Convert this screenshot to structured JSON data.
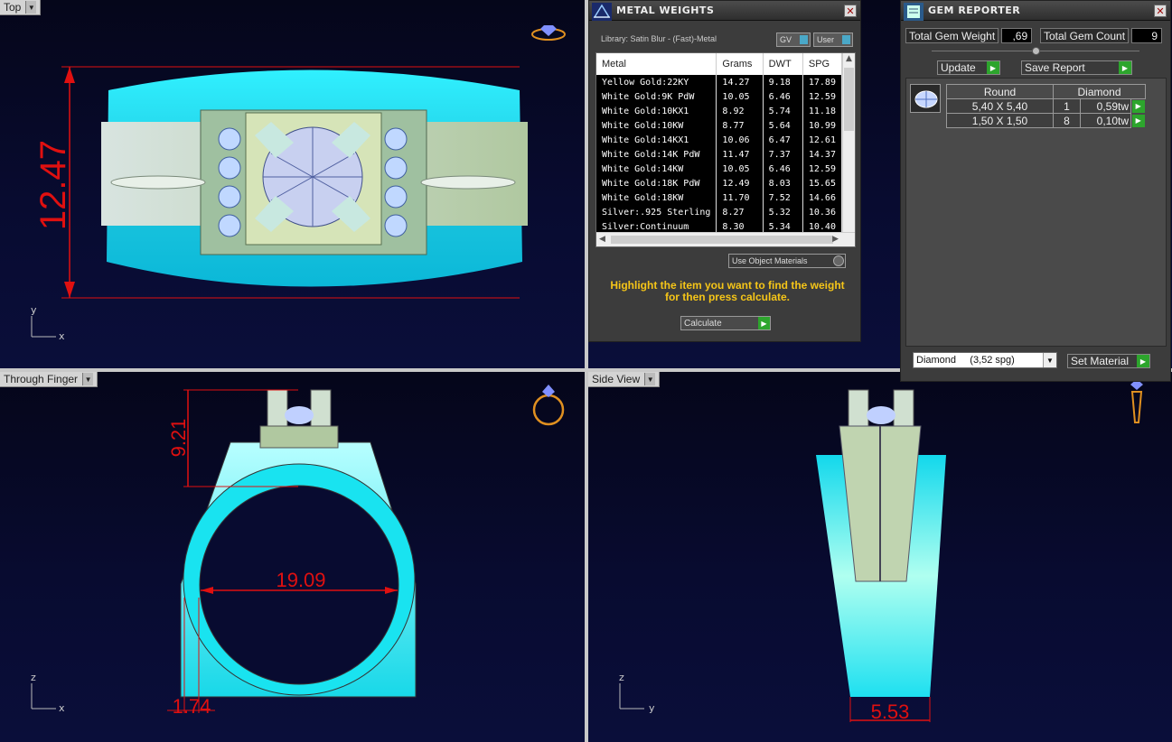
{
  "viewports": {
    "top": {
      "label": "Top"
    },
    "finger": {
      "label": "Through Finger"
    },
    "side": {
      "label": "Side View"
    }
  },
  "dimensions": {
    "top_height": "12.47",
    "finger_top": "9.21",
    "finger_diameter": "19.09",
    "finger_thickness": "1.74",
    "side_width": "5.53"
  },
  "axes": {
    "x": "x",
    "y": "y",
    "z": "z"
  },
  "metal_weights": {
    "title": "METAL WEIGHTS",
    "library": "Library: Satin Blur - (Fast)-Metal",
    "gv_label": "GV",
    "user_label": "User",
    "columns": [
      "Metal",
      "Grams",
      "DWT",
      "SPG"
    ],
    "rows": [
      [
        "Yellow Gold:22KY",
        "14.27",
        "9.18",
        "17.89"
      ],
      [
        "White Gold:9K PdW",
        "10.05",
        "6.46",
        "12.59"
      ],
      [
        "White Gold:10KX1",
        "8.92",
        "5.74",
        "11.18"
      ],
      [
        "White Gold:10KW",
        "8.77",
        "5.64",
        "10.99"
      ],
      [
        "White Gold:14KX1",
        "10.06",
        "6.47",
        "12.61"
      ],
      [
        "White Gold:14K PdW",
        "11.47",
        "7.37",
        "14.37"
      ],
      [
        "White Gold:14KW",
        "10.05",
        "6.46",
        "12.59"
      ],
      [
        "White Gold:18K PdW",
        "12.49",
        "8.03",
        "15.65"
      ],
      [
        "White Gold:18KW",
        "11.70",
        "7.52",
        "14.66"
      ],
      [
        "Silver:.925 Sterling",
        "8.27",
        "5.32",
        "10.36"
      ],
      [
        "Silver:Continuum",
        "8.30",
        "5.34",
        "10.40"
      ]
    ],
    "use_object_materials": "Use Object Materials",
    "hint": "Highlight the item you want to find the weight for then press calculate.",
    "calculate": "Calculate"
  },
  "gem_reporter": {
    "title": "GEM REPORTER",
    "total_weight_label": "Total Gem Weight",
    "total_weight_value": ",69",
    "total_count_label": "Total Gem Count",
    "total_count_value": "9",
    "update": "Update",
    "save_report": "Save Report",
    "table_headers": [
      "Round",
      "Diamond"
    ],
    "rows": [
      {
        "size": "5,40 X 5,40",
        "count": "1",
        "weight": "0,59tw"
      },
      {
        "size": "1,50 X 1,50",
        "count": "8",
        "weight": "0,10tw"
      }
    ],
    "material_select": "Diamond     (3,52 spg)",
    "set_material": "Set Material"
  },
  "colors": {
    "dimension": "#e01010",
    "ring_cyan": "#19e3f0",
    "metal": "#c8d8b0",
    "accent_green": "#2da52d"
  }
}
